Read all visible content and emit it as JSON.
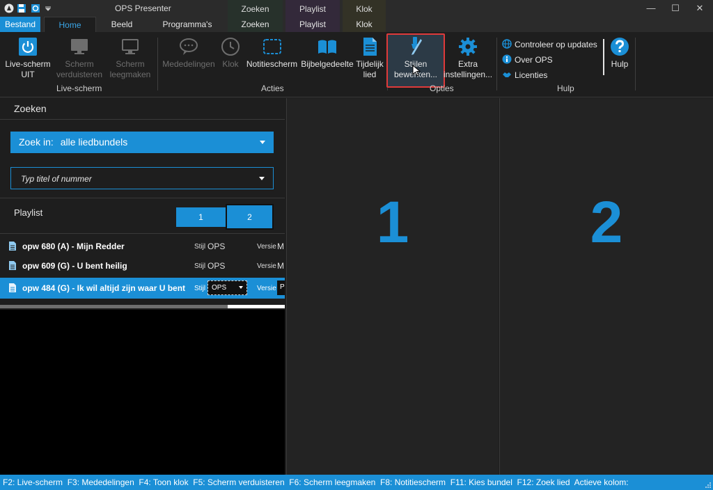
{
  "window": {
    "title": "OPS Presenter",
    "context_tabs_top": [
      "Zoeken",
      "Playlist",
      "Klok"
    ],
    "controls": {
      "minimize": "—",
      "maximize": "☐",
      "close": "✕"
    }
  },
  "quick_access": [
    "ops-logo-icon",
    "save-icon",
    "refresh-icon",
    "dropdown-arrow-icon"
  ],
  "tabs": {
    "bestand": "Bestand",
    "home": "Home",
    "beeld": "Beeld",
    "programmas": "Programma's",
    "zoeken": "Zoeken",
    "playlist": "Playlist",
    "klok": "Klok"
  },
  "ribbon": {
    "live_uit": "Live-scherm\nUIT",
    "verduisteren": "Scherm\nverduisteren",
    "leegmaken": "Scherm\nleegmaken",
    "group_live": "Live-scherm",
    "mededelingen": "Mededelingen",
    "klok": "Klok",
    "notitiescherm": "Notitiescherm",
    "bijbelgedeelte": "Bijbelgedeelte",
    "tijdelijk": "Tijdelijk\nlied",
    "group_acties": "Acties",
    "stijlen": "Stijlen\nbewerken...",
    "extra": "Extra\ninstellingen...",
    "group_opties": "Opties",
    "updates": "Controleer op updates",
    "over": "Over OPS",
    "licenties": "Licenties",
    "hulp": "Hulp",
    "group_hulp": "Hulp"
  },
  "search_panel": {
    "title": "Zoeken",
    "zoek_in_label": "Zoek in:",
    "zoek_in_value": "alle liedbundels",
    "search_placeholder": "Typ titel of nummer"
  },
  "playlist": {
    "title": "Playlist",
    "btn1": "1",
    "btn2": "2",
    "items": [
      {
        "title": "opw 680 (A) - Mijn Redder",
        "stijl_label": "Stijl",
        "stijl": "OPS",
        "versie_label": "Versie",
        "versie": "M"
      },
      {
        "title": "opw 609 (G) - U bent heilig",
        "stijl_label": "Stijl",
        "stijl": "OPS",
        "versie_label": "Versie",
        "versie": "M"
      },
      {
        "title": "opw 484 (G) - Ik wil altijd zijn waar U bent",
        "stijl_label": "Stijl",
        "stijl": "OPS",
        "versie_label": "Versie",
        "versie": "P"
      }
    ]
  },
  "preview": {
    "col1": "1",
    "col2": "2"
  },
  "status_bar": "F2: Live-scherm  F3: Mededelingen  F4: Toon klok  F5: Scherm verduisteren  F6: Scherm leegmaken  F8: Notitiescherm  F11: Kies bundel  F12: Zoek lied  Actieve kolom:",
  "colors": {
    "accent": "#1b8fd6",
    "highlight": "#e03a3a",
    "background": "#1e1e1e"
  }
}
